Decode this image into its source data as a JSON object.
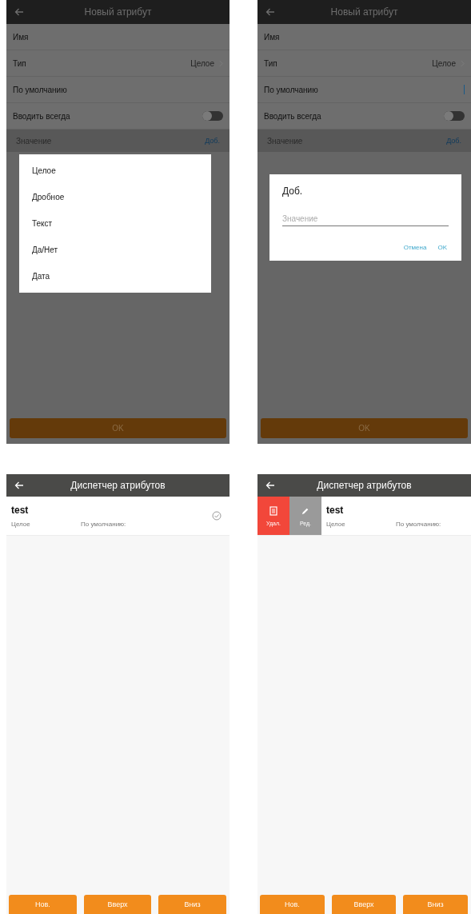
{
  "screens": [
    {
      "kind": "form",
      "title": "Новый атрибут",
      "fields": [
        {
          "kind": "text",
          "label": "Имя",
          "focused": false
        },
        {
          "kind": "select",
          "label": "Тип",
          "value": "Целое"
        },
        {
          "kind": "text",
          "label": "По умолчанию",
          "focused": false
        },
        {
          "kind": "toggle",
          "label": "Вводить всегда",
          "on": false
        }
      ],
      "values_header": {
        "label": "Значение",
        "action": "Доб."
      },
      "submit": "OK",
      "dialog": {
        "kind": "menu",
        "options": [
          "Целое",
          "Дробное",
          "Текст",
          "Да/Нет",
          "Дата"
        ]
      }
    },
    {
      "kind": "form",
      "title": "Новый атрибут",
      "fields": [
        {
          "kind": "text",
          "label": "Имя",
          "focused": false
        },
        {
          "kind": "select",
          "label": "Тип",
          "value": "Целое"
        },
        {
          "kind": "text",
          "label": "По умолчанию",
          "focused": true
        },
        {
          "kind": "toggle",
          "label": "Вводить всегда",
          "on": false
        }
      ],
      "values_header": {
        "label": "Значение",
        "action": "Доб."
      },
      "submit": "OK",
      "dialog": {
        "kind": "prompt",
        "title": "Доб.",
        "placeholder": "Значение",
        "buttons": [
          "Отмена",
          "OK"
        ]
      }
    },
    {
      "kind": "list",
      "title": "Диспетчер атрибутов",
      "items": [
        {
          "name": "test",
          "type": "Целое",
          "default_label": "По умолчанию:",
          "swiped": false
        }
      ],
      "buttons": [
        "Нов.",
        "Вверх",
        "Вниз"
      ]
    },
    {
      "kind": "list",
      "title": "Диспетчер атрибутов",
      "items": [
        {
          "name": "test",
          "type": "Целое",
          "default_label": "По умолчанию:",
          "swiped": true
        }
      ],
      "actions": [
        {
          "kind": "delete",
          "label": "Удал."
        },
        {
          "kind": "edit",
          "label": "Ред."
        }
      ],
      "buttons": [
        "Нов.",
        "Вверх",
        "Вниз"
      ]
    }
  ]
}
